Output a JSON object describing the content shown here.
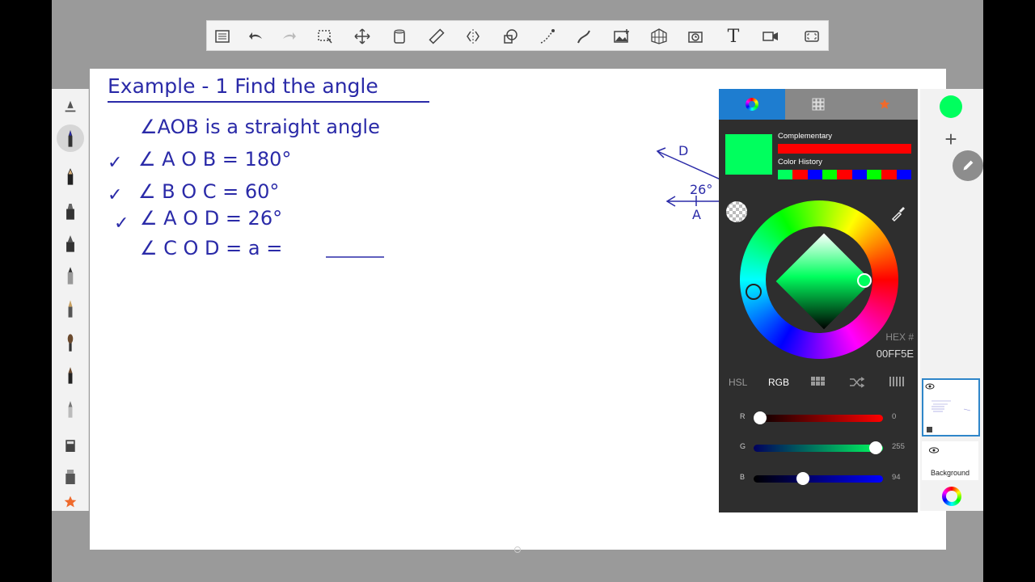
{
  "toolbar": {
    "items": [
      "list-icon",
      "undo-icon",
      "redo-icon",
      "selection-icon",
      "transform-icon",
      "fill-icon",
      "ruler-icon",
      "symmetry-icon",
      "shape-icon",
      "stroke-icon",
      "curve-icon",
      "image-icon",
      "perspective-icon",
      "time-lapse-icon",
      "text-icon",
      "video-icon",
      "fullscreen-icon"
    ],
    "text_tool_label": "T"
  },
  "drawing": {
    "title": "Example - 1   Find the angle",
    "line1": "∠AOB  is  a  straight  angle",
    "line2": "∠ A O B  =  180°",
    "line3": "∠ B O C  =  60°",
    "line4": "∠ A O D  =  26°",
    "line5": "∠ C O D  =  a  =",
    "check": "✓",
    "diagram_label_d": "D",
    "diagram_label_angle": "26°",
    "diagram_label_a": "A"
  },
  "color_editor": {
    "tabs": [
      "color-wheel-icon",
      "palette-grid-icon",
      "favorites-star-icon"
    ],
    "complementary_label": "Complementary",
    "history_label": "Color History",
    "history_colors": [
      "#00ff5e",
      "#ff0000",
      "#0000ff",
      "#00ff00",
      "#ff0000",
      "#0000ff",
      "#00ff00",
      "#ff0000",
      "#0000ff"
    ],
    "current_color": "#00ff5e",
    "complementary_color": "#ff0000",
    "hex_label": "HEX #",
    "hex_value": "00FF5E",
    "modes": {
      "hsl": "HSL",
      "rgb": "RGB"
    },
    "sliders": {
      "r": {
        "label": "R",
        "value": "0"
      },
      "g": {
        "label": "G",
        "value": "255"
      },
      "b": {
        "label": "B",
        "value": "94"
      }
    }
  },
  "layers": {
    "background_label": "Background"
  }
}
